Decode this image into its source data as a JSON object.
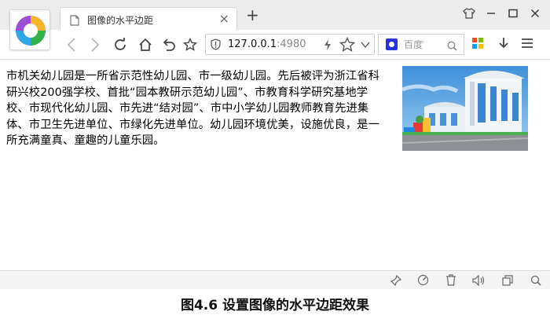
{
  "tab": {
    "title": "图像的水平边距",
    "close_glyph": "×",
    "new_tab_glyph": "+"
  },
  "address_bar": {
    "host": "127.0.0.1",
    "port": ":4980"
  },
  "search": {
    "placeholder": "百度"
  },
  "content": {
    "paragraph": "市机关幼儿园是一所省示范性幼儿园、市一级幼儿园。先后被评为浙江省科研兴校200强学校、首批“园本教研示范幼儿园”、市教育科学研究基地学校、市现代化幼儿园、市先进“结对园”、市中小学幼儿园教师教育先进集体、市卫生先进单位、市绿化先进单位。幼儿园环境优美，设施优良，是一所充满童真、童趣的儿童乐园。"
  },
  "caption": {
    "text": "图4.6  设置图像的水平边距效果"
  },
  "icons": {
    "browser_logo": "browser-logo-icon",
    "page": "page-icon",
    "tshirt": "skin-icon",
    "back": "back-arrow-icon",
    "forward": "forward-arrow-icon",
    "reload": "reload-icon",
    "home": "home-icon",
    "undo": "undo-icon",
    "bookmark": "star-icon",
    "shield": "shield-icon",
    "bolt": "lightning-icon",
    "apps": "apps-grid-icon",
    "download": "download-icon",
    "menu": "menu-icon"
  },
  "colors": {
    "tab_strip": "#ececec",
    "status_bar": "#f4f4f4",
    "text": "#000000"
  }
}
